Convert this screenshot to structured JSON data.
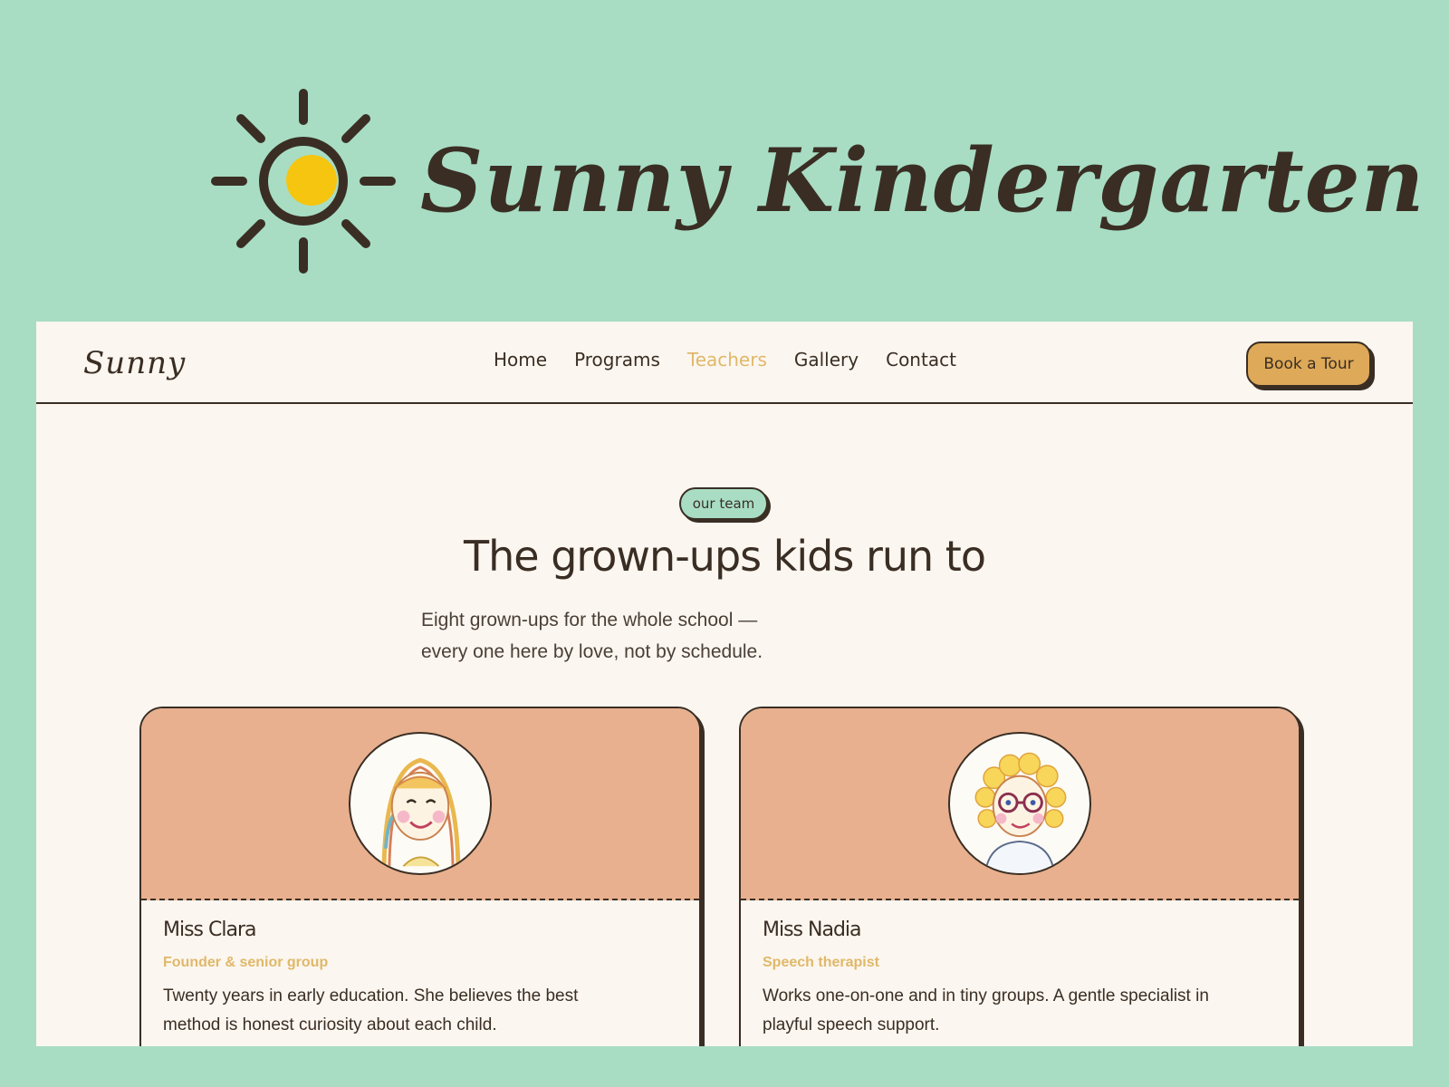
{
  "brand": {
    "title": "Sunny Kindergarten",
    "logo_icon": "sun-icon",
    "sun_color": "#f5c50f"
  },
  "nav": {
    "logo": "Sunny",
    "links": [
      "Home",
      "Programs",
      "Teachers",
      "Gallery",
      "Contact"
    ],
    "active": "Teachers",
    "cta": "Book a Tour"
  },
  "hero": {
    "badge": "our team",
    "title": "The grown-ups kids run to",
    "subtitle_line1": "Eight grown-ups for the whole school —",
    "subtitle_line2": "every one here by love, not by schedule."
  },
  "teachers": [
    {
      "name": "Miss Clara",
      "role": "Founder & senior group",
      "desc_line1": "Twenty years in early education. She believes the best",
      "desc_line2": "method is honest curiosity about each child.",
      "avatar_icon": "girl-avatar-icon"
    },
    {
      "name": "Miss Nadia",
      "role": "Speech therapist",
      "desc_line1": "Works one-on-one and in tiny groups. A gentle specialist in",
      "desc_line2": "playful speech support.",
      "avatar_icon": "curly-hair-glasses-avatar-icon"
    }
  ],
  "colors": {
    "background": "#a8ddc4",
    "page": "#fbf6ef",
    "ink": "#3a2e24",
    "accent": "#e0b86a",
    "button": "#dea958",
    "card_top": "#e8b08e"
  }
}
